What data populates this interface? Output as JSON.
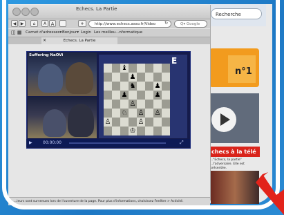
{
  "browser": {
    "title": "Echecs. La Partie",
    "back_label": "◀",
    "forward_label": "▶",
    "home_label": "⌂",
    "text_small_label": "A",
    "text_large_label": "A",
    "add_label": "+",
    "url": "http://www.echecs.asso.fr/Video",
    "google_placeholder": "Q▾ Google",
    "bookmarks": [
      "Carnet d'adresses▾",
      "Bonjour▾",
      "Login",
      "Les meilleu...nformatique"
    ],
    "tab_label": "Echecs. La Partie",
    "status_text": "...ieurs sont survenues lors de l'ouverture de la page. Pour plus d'informations, choisissez Fenêtre > Activité."
  },
  "player": {
    "overlay_label": "Suffering NaOVi",
    "time": "00:00:00",
    "logo": "E",
    "board_ranks": [
      "  ♝     ",
      "   ♟    ",
      "   ♞  ♟ ",
      "  ♟   ♟ ",
      "   ♙    ",
      "  ♘ ♙ ♙ ",
      "♙   ♙   ",
      "   ♔    "
    ]
  },
  "site": {
    "search_label": "Recherche",
    "badge_label": "n°1",
    "headline": "checs à la télé",
    "body_text": "...\"Echecs, la partie\" ...l'adversaire. Elle est présentée."
  },
  "colors": {
    "player_bg": "#151b4b",
    "accent_red": "#d9241b",
    "frame_blue": "#2a8fd6"
  }
}
